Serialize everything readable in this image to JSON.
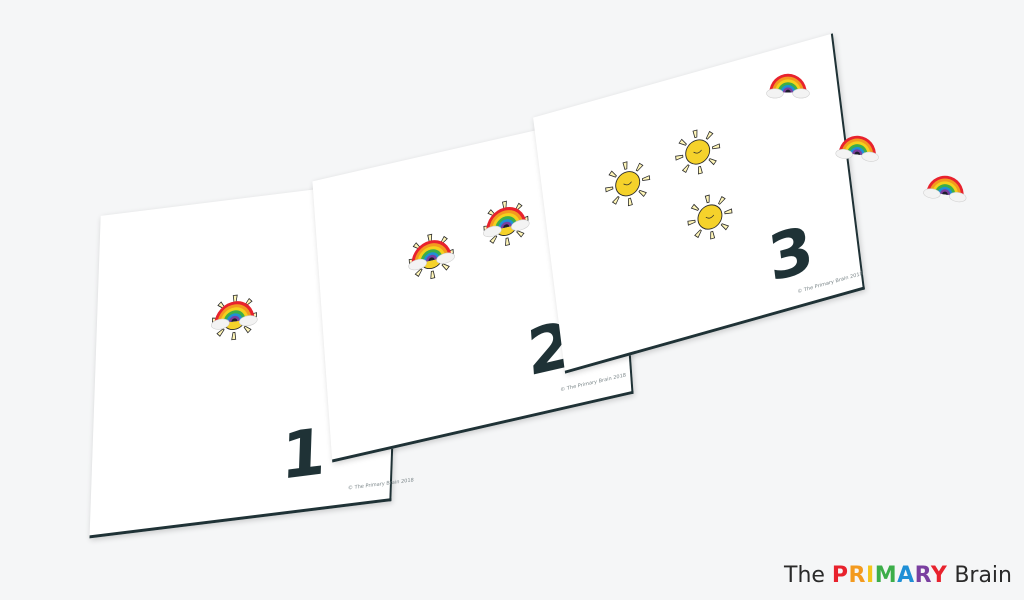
{
  "cards": [
    {
      "number": "1",
      "copyright": "© The Primary Brain 2018"
    },
    {
      "number": "2",
      "copyright": "© The Primary Brain 2018"
    },
    {
      "number": "3",
      "copyright": "© The Primary Brain 2018"
    }
  ],
  "logo": {
    "the": "The",
    "primary": "PRIMARY",
    "brain": "Brain"
  },
  "logo_colors": [
    "#e8222d",
    "#f39a1f",
    "#f4c51c",
    "#3cae49",
    "#1f8fd6",
    "#7a3fa0",
    "#e8222d"
  ],
  "colors": {
    "rainbow": [
      "#e8222d",
      "#f39a1f",
      "#f4d11c",
      "#3cae49",
      "#1f8fd6",
      "#7a3fa0"
    ],
    "sun": "#f5d22b",
    "card_border": "#1f3236"
  }
}
